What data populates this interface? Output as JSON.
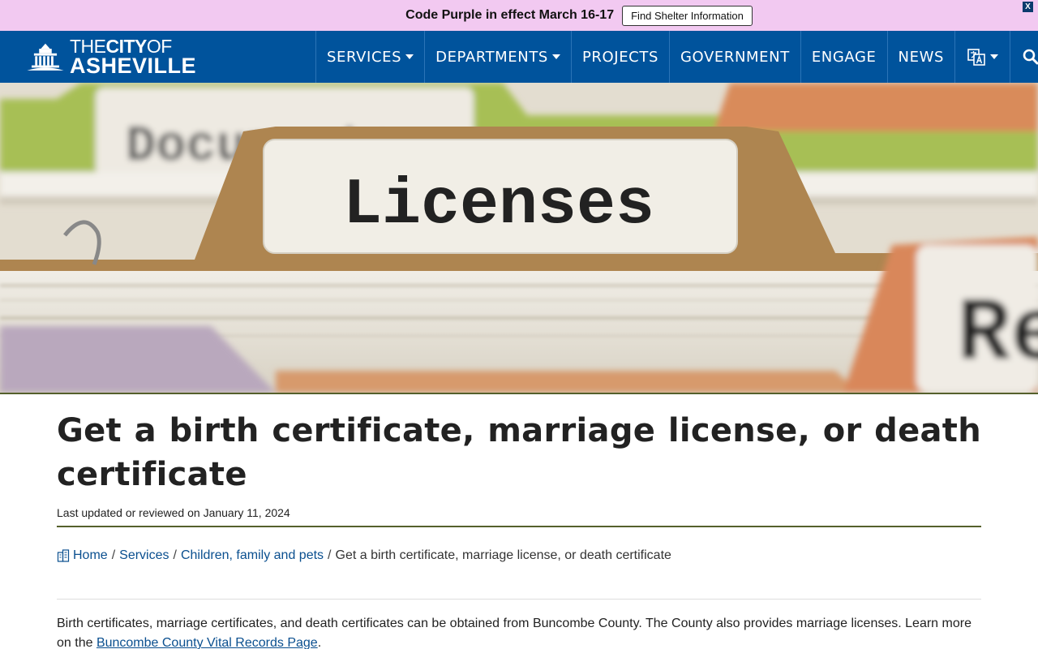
{
  "alert": {
    "message": "Code Purple in effect March 16-17",
    "button_label": "Find Shelter Information",
    "close_label": "X"
  },
  "logo": {
    "line1_a": "THE",
    "line1_b": "CITY",
    "line1_c": "OF",
    "line2": "ASHEVILLE"
  },
  "nav": {
    "items": [
      {
        "label": "SERVICES",
        "has_dropdown": true
      },
      {
        "label": "DEPARTMENTS",
        "has_dropdown": true
      },
      {
        "label": "PROJECTS",
        "has_dropdown": false
      },
      {
        "label": "GOVERNMENT",
        "has_dropdown": false
      },
      {
        "label": "ENGAGE",
        "has_dropdown": false
      },
      {
        "label": "NEWS",
        "has_dropdown": false
      }
    ],
    "language_icon": "translate-icon",
    "search_icon": "search-icon"
  },
  "hero": {
    "folder_main": "Licenses",
    "folder_back": "Documents",
    "folder_right": "Re"
  },
  "page": {
    "title": "Get a birth certificate, marriage license, or death certificate",
    "updated": "Last updated or reviewed on January 11, 2024"
  },
  "breadcrumb": {
    "home": "Home",
    "services": "Services",
    "category": "Children, family and pets",
    "current": "Get a birth certificate, marriage license, or death certificate",
    "separator": "/"
  },
  "body": {
    "text_before": "Birth certificates, marriage certificates, and death certificates can be obtained from Buncombe County. The County also provides marriage licenses. Learn more on the ",
    "link_text": "Buncombe County Vital Records Page",
    "text_after": "."
  },
  "colors": {
    "alert_bg": "#f2c9f1",
    "nav_bg": "#00539c",
    "accent_line": "#55602c",
    "link": "#0a4f8f"
  }
}
